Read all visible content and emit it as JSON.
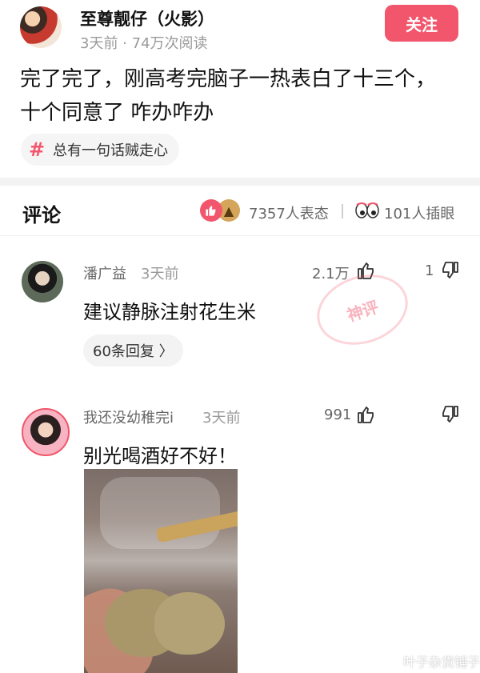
{
  "post": {
    "author_name": "至尊靓仔（火影）",
    "meta": "3天前 · 74万次阅读",
    "follow_label": "关注",
    "body_line1": "完了完了，刚高考完脑子一热表白了十三个，",
    "body_line2": "十个同意了 咋办咋办",
    "topic_label": "总有一句话贼走心"
  },
  "comments_header": {
    "title": "评论",
    "reactions_count": "7357人表态",
    "eyes_count": "101人插眼"
  },
  "comments": [
    {
      "name": "潘广益",
      "time": "3天前",
      "like_count": "2.1万",
      "down_count": "1",
      "text": "建议静脉注射花生米",
      "replies_label": "60条回复 〉",
      "stamp_text": "神评"
    },
    {
      "name": "我还没幼稚完i",
      "time": "3天前",
      "like_count": "991",
      "down_count": "",
      "text": "别光喝酒好不好！"
    }
  ],
  "watermark": "叶子杂货铺子",
  "colors": {
    "accent": "#f2566c"
  },
  "icons": {
    "like": "thumbs-up-icon",
    "dislike": "thumbs-down-icon",
    "topic": "hashtag-icon",
    "eyes": "eyes-icon"
  }
}
